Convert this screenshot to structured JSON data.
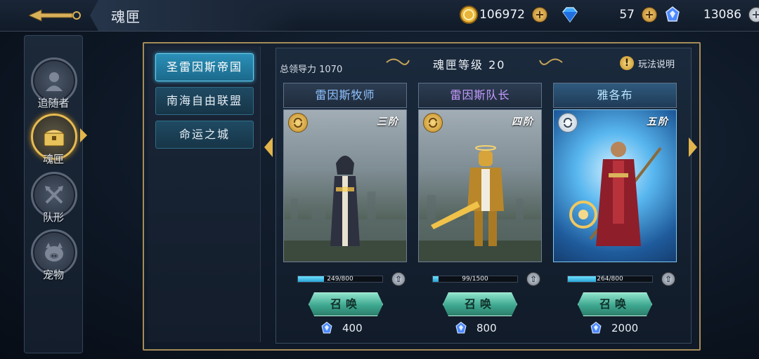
{
  "header": {
    "title": "魂匣",
    "resources": [
      {
        "icon": "gold-coin-icon",
        "value": "106972"
      },
      {
        "icon": "diamond-icon",
        "value": "57"
      },
      {
        "icon": "soul-crystal-icon",
        "value": "13086"
      }
    ]
  },
  "sidebar": {
    "items": [
      {
        "label": "追随者",
        "icon": "follower-icon",
        "active": false
      },
      {
        "label": "魂匣",
        "icon": "soul-box-icon",
        "active": true
      },
      {
        "label": "队形",
        "icon": "formation-icon",
        "active": false
      },
      {
        "label": "宠物",
        "icon": "pet-icon",
        "active": false
      }
    ]
  },
  "kingdoms": [
    {
      "label": "圣雷因斯帝国",
      "active": true
    },
    {
      "label": "南海自由联盟",
      "active": false
    },
    {
      "label": "命运之城",
      "active": false
    }
  ],
  "main": {
    "leadership": "总领导力 1070",
    "level_title": "魂匣等级 20",
    "help_label": "玩法说明"
  },
  "cards": [
    {
      "name": "雷因斯牧师",
      "tier": "三阶",
      "progress_text": "249/800",
      "progress": 0.31,
      "summon_label": "召唤",
      "cost": "400"
    },
    {
      "name": "雷因斯队长",
      "tier": "四阶",
      "progress_text": "99/1500",
      "progress": 0.07,
      "summon_label": "召唤",
      "cost": "800"
    },
    {
      "name": "雅各布",
      "tier": "五阶",
      "progress_text": "264/800",
      "progress": 0.33,
      "summon_label": "召唤",
      "cost": "2000"
    }
  ],
  "colors": {
    "gold": "#e2b54c",
    "teal_button": "#3ea78f",
    "active_blue": "#2b90b8",
    "progress_cyan": "#2aa4d6"
  }
}
